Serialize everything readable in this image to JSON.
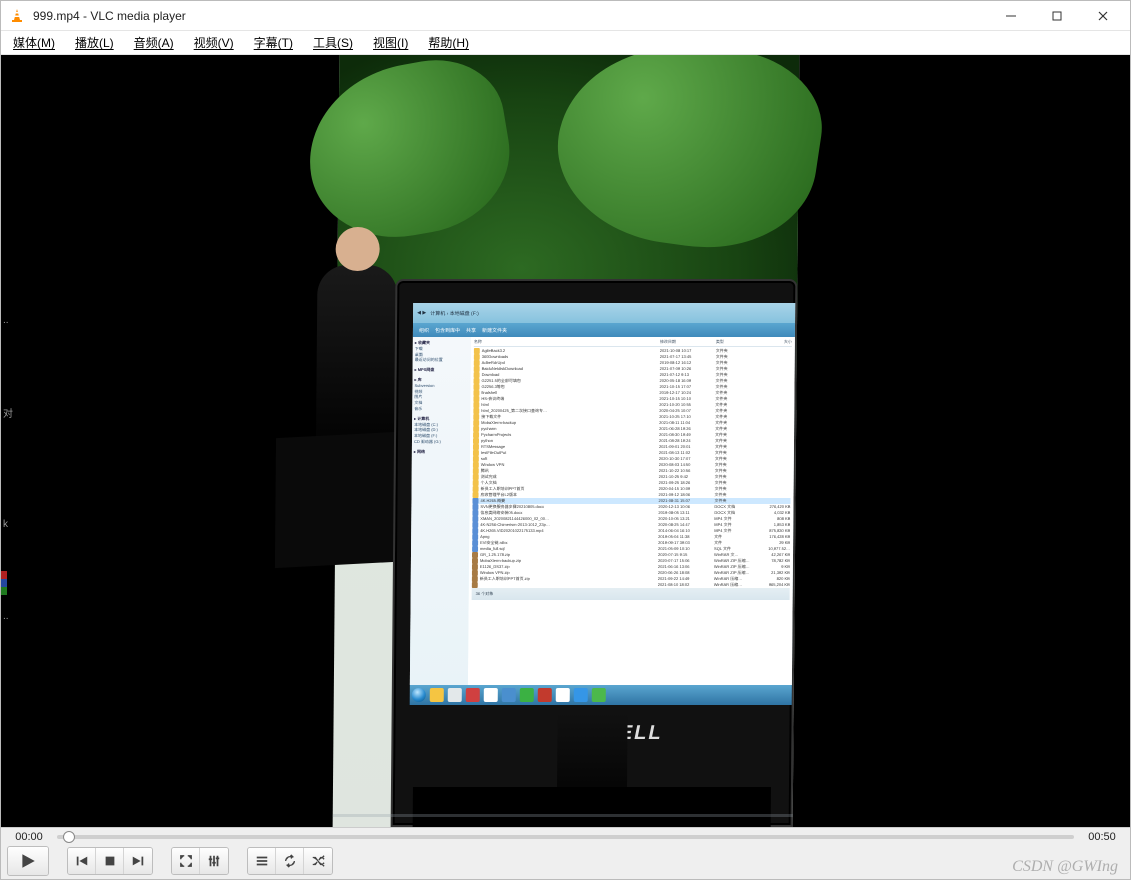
{
  "window": {
    "title": "999.mp4 - VLC media player"
  },
  "menubar": {
    "media": "媒体(M)",
    "playback": "播放(L)",
    "audio": "音频(A)",
    "video": "视频(V)",
    "subtitle": "字幕(T)",
    "tools": "工具(S)",
    "view": "视图(I)",
    "help": "帮助(H)"
  },
  "playback": {
    "current_time": "00:00",
    "total_time": "00:50"
  },
  "watermark": "CSDN @GWIng",
  "inner_monitor": {
    "brand": "DELL",
    "explorer": {
      "path": "计算机 › 本地磁盘 (F:)",
      "toolbar": [
        "组织",
        "包含到库中",
        "共享",
        "新建文件夹"
      ],
      "nav_sections": [
        {
          "title": "收藏夹",
          "items": [
            "下载",
            "桌面",
            "最近访问的位置"
          ]
        },
        {
          "title": "MPS网盘",
          "items": []
        },
        {
          "title": "库",
          "items": [
            "Subversion",
            "视频",
            "图片",
            "文档",
            "音乐"
          ]
        },
        {
          "title": "计算机",
          "items": [
            "本地磁盘 (C:)",
            "本地磁盘 (D:)",
            "本地磁盘 (F:)",
            "CD 驱动器 (G:)"
          ]
        },
        {
          "title": "网络",
          "items": []
        }
      ],
      "columns": [
        "名称",
        "修改日期",
        "类型",
        "大小"
      ],
      "status": "36 个对象",
      "items": [
        {
          "ic": "f",
          "name": "AgileBack3.2",
          "date": "2021-10-08 10:17",
          "type": "文件夹",
          "size": ""
        },
        {
          "ic": "f",
          "name": "360Downloads",
          "date": "2021-07-17 13:45",
          "type": "文件夹",
          "size": ""
        },
        {
          "ic": "f",
          "name": "AdbeRdrUpd",
          "date": "2019-08-12 16:12",
          "type": "文件夹",
          "size": ""
        },
        {
          "ic": "f",
          "name": "BaiduNetdiskDownload",
          "date": "2021-07-09 10:26",
          "type": "文件夹",
          "size": ""
        },
        {
          "ic": "f",
          "name": "Download",
          "date": "2021-07-12 9:13",
          "type": "文件夹",
          "size": ""
        },
        {
          "ic": "f",
          "name": "G2251.5的全部可填包",
          "date": "2020-05-18 16:09",
          "type": "文件夹",
          "size": ""
        },
        {
          "ic": "f",
          "name": "G2256.3等包",
          "date": "2021-10-15 17:07",
          "type": "文件夹",
          "size": ""
        },
        {
          "ic": "f",
          "name": "finalshell",
          "date": "2019-12-17 10:24",
          "type": "文件夹",
          "size": ""
        },
        {
          "ic": "f",
          "name": "HS-会议终端",
          "date": "2021-10-15 10:10",
          "type": "文件夹",
          "size": ""
        },
        {
          "ic": "f",
          "name": "html",
          "date": "2021-10-20 10:55",
          "type": "文件夹",
          "size": ""
        },
        {
          "ic": "f",
          "name": "html_20200425_第二次接口查询专…",
          "date": "2020-04-25 10:07",
          "type": "文件夹",
          "size": ""
        },
        {
          "ic": "f",
          "name": "接下载文件",
          "date": "2021-10-25 17:10",
          "type": "文件夹",
          "size": ""
        },
        {
          "ic": "f",
          "name": "MobaXterm-backup",
          "date": "2021-08-11 11:04",
          "type": "文件夹",
          "size": ""
        },
        {
          "ic": "f",
          "name": "pycharm",
          "date": "2021-06-28 19:26",
          "type": "文件夹",
          "size": ""
        },
        {
          "ic": "f",
          "name": "PycharmProjects",
          "date": "2021-08-30 19:49",
          "type": "文件夹",
          "size": ""
        },
        {
          "ic": "f",
          "name": "python",
          "date": "2021-08-28 19:24",
          "type": "文件夹",
          "size": ""
        },
        {
          "ic": "f",
          "name": "RTSMessage",
          "date": "2021-09-01 20:01",
          "type": "文件夹",
          "size": ""
        },
        {
          "ic": "f",
          "name": "testFileOutPut",
          "date": "2021-08-13 11:02",
          "type": "文件夹",
          "size": ""
        },
        {
          "ic": "f",
          "name": "soft",
          "date": "2020-10-30 17:07",
          "type": "文件夹",
          "size": ""
        },
        {
          "ic": "f",
          "name": "Window VPN",
          "date": "2020-08-03 14:50",
          "type": "文件夹",
          "size": ""
        },
        {
          "ic": "f",
          "name": "腾讯",
          "date": "2021-10-22 10:56",
          "type": "文件夹",
          "size": ""
        },
        {
          "ic": "f",
          "name": "测试完成",
          "date": "2021-10-25 9:42",
          "type": "文件夹",
          "size": ""
        },
        {
          "ic": "f",
          "name": "个人文档",
          "date": "2021-09-25 18:26",
          "type": "文件夹",
          "size": ""
        },
        {
          "ic": "f",
          "name": "新员工入职培训PPT首页",
          "date": "2020-04-15 10:09",
          "type": "文件夹",
          "size": ""
        },
        {
          "ic": "f",
          "name": "应收管理平台L2版本",
          "date": "2021-09-12 18:06",
          "type": "文件夹",
          "size": ""
        },
        {
          "ic": "d",
          "name": "4K.H265.概要",
          "date": "2021-08-31 15:07",
          "type": "文件夹",
          "size": "",
          "sel": true
        },
        {
          "ic": "d",
          "name": "SVN更换服务器步骤20210805.docx",
          "date": "2020-12-13 10:06",
          "type": "DOCX 文档",
          "size": "276,420 KB"
        },
        {
          "ic": "d",
          "name": "信息类网络安装05.docx",
          "date": "2019-08-05 13:11",
          "type": "DOCX 文档",
          "size": "4,032 KB"
        },
        {
          "ic": "d",
          "name": "XMAN_20200821144426000_02_00…",
          "date": "2020-10-05 13:21",
          "type": "MP4 文件",
          "size": "808 KB"
        },
        {
          "ic": "d",
          "name": "4K-N256-Chimerism-2013-1012_23p…",
          "date": "2020-08-25 14:47",
          "type": "MP4 文件",
          "size": "1,853 KB"
        },
        {
          "ic": "d",
          "name": "4K.H265.VID20201022175133.mp4",
          "date": "2014-06-04 16:10",
          "type": "MP4 文件",
          "size": "875,830 KB"
        },
        {
          "ic": "d",
          "name": "Apng",
          "date": "2019-05-04 11:38",
          "type": "文件",
          "size": "176,428 KB"
        },
        {
          "ic": "d",
          "name": "EVI安全链.rdbx",
          "date": "2019-09-17 39:03",
          "type": "文件",
          "size": "29 KB"
        },
        {
          "ic": "d",
          "name": "media_full.sql",
          "date": "2021-05-09 10:10",
          "type": "SQL 文件",
          "size": "10,977.52…"
        },
        {
          "ic": "z",
          "name": "GR_1.25.178.zip",
          "date": "2020-07-15 9:15",
          "type": "WinRAR 文…",
          "size": "42,267 KB"
        },
        {
          "ic": "z",
          "name": "MobaXterm-backup.zip",
          "date": "2020-07-17 15:06",
          "type": "WinRAR ZIP 压缩…",
          "size": "78,782 KB"
        },
        {
          "ic": "z",
          "name": "E1126_DS37.zip",
          "date": "2021-06-16 13:06",
          "type": "WinRAR ZIP 压缩…",
          "size": "9 KB"
        },
        {
          "ic": "z",
          "name": "Window VPN.zip",
          "date": "2020-06-26 18:08",
          "type": "WinRAR ZIP 压缩…",
          "size": "21,392 KB"
        },
        {
          "ic": "z",
          "name": "新员工入职培训PPT首页.zip",
          "date": "2021-09-22 14:49",
          "type": "WinRAR 压缩…",
          "size": "820 KB"
        },
        {
          "ic": "z",
          "name": "",
          "date": "2021-08-10 18:02",
          "type": "WinRAR 压缩…",
          "size": "965,204 KB"
        }
      ]
    }
  }
}
